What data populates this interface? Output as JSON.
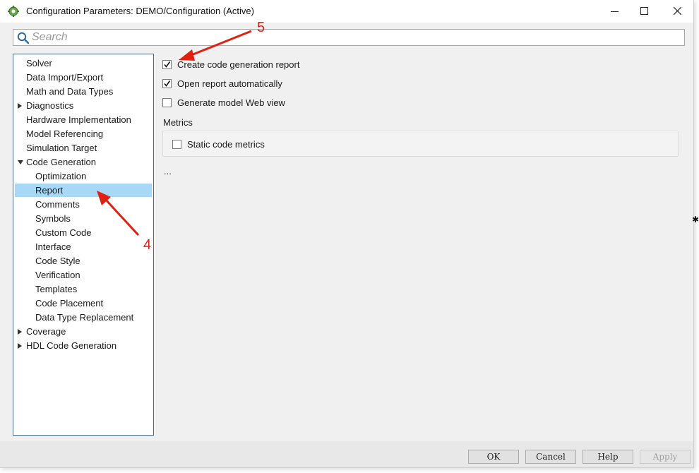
{
  "window": {
    "title": "Configuration Parameters: DEMO/Configuration (Active)"
  },
  "search": {
    "placeholder": "Search"
  },
  "tree": {
    "items": [
      {
        "label": "Solver",
        "expander": ""
      },
      {
        "label": "Data Import/Export",
        "expander": ""
      },
      {
        "label": "Math and Data Types",
        "expander": ""
      },
      {
        "label": "Diagnostics",
        "expander": "collapsed"
      },
      {
        "label": "Hardware Implementation",
        "expander": ""
      },
      {
        "label": "Model Referencing",
        "expander": ""
      },
      {
        "label": "Simulation Target",
        "expander": ""
      },
      {
        "label": "Code Generation",
        "expander": "expanded"
      },
      {
        "label": "Optimization",
        "expander": ""
      },
      {
        "label": "Report",
        "expander": "",
        "selected": true
      },
      {
        "label": "Comments",
        "expander": ""
      },
      {
        "label": "Symbols",
        "expander": ""
      },
      {
        "label": "Custom Code",
        "expander": ""
      },
      {
        "label": "Interface",
        "expander": ""
      },
      {
        "label": "Code Style",
        "expander": ""
      },
      {
        "label": "Verification",
        "expander": ""
      },
      {
        "label": "Templates",
        "expander": ""
      },
      {
        "label": "Code Placement",
        "expander": ""
      },
      {
        "label": "Data Type Replacement",
        "expander": ""
      },
      {
        "label": "Coverage",
        "expander": "collapsed"
      },
      {
        "label": "HDL Code Generation",
        "expander": "collapsed"
      }
    ],
    "selected_color": "#a8d8f8"
  },
  "report": {
    "options": [
      {
        "label": "Create code generation report",
        "checked": true
      },
      {
        "label": "Open report automatically",
        "checked": true
      },
      {
        "label": "Generate model Web view",
        "checked": false
      }
    ],
    "metrics_title": "Metrics",
    "metrics_options": [
      {
        "label": "Static code metrics",
        "checked": false
      }
    ],
    "more": "..."
  },
  "buttons": {
    "ok": "OK",
    "cancel": "Cancel",
    "help": "Help",
    "apply": "Apply"
  },
  "annotations": {
    "step4": "4",
    "step5": "5",
    "color": "#e02010"
  }
}
